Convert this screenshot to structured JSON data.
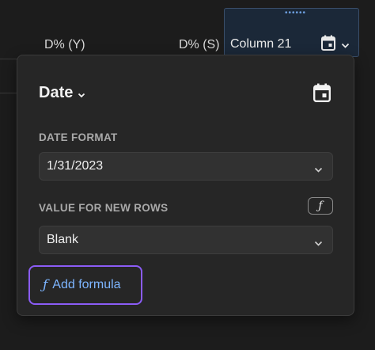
{
  "columns": {
    "d_pct_y": "D% (Y)",
    "d_pct_s": "D% (S)",
    "column_21": "Column 21"
  },
  "popover": {
    "type_label": "Date",
    "type_icon": "calendar-icon",
    "date_format_label": "DATE FORMAT",
    "date_format_value": "1/31/2023",
    "new_rows_label": "VALUE FOR NEW ROWS",
    "new_rows_value": "Blank",
    "fx_symbol": "ƒ",
    "add_formula_label": "Add formula"
  },
  "colors": {
    "accent_purple": "#8b5cf6",
    "link_blue": "#7db5ff",
    "selected_column_bg": "#1b2838"
  }
}
